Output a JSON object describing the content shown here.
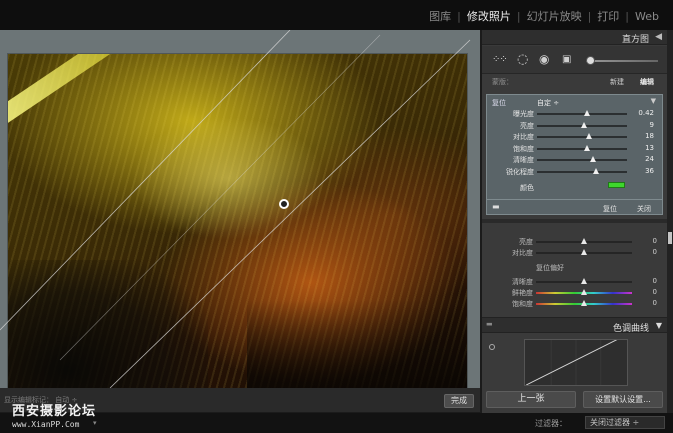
{
  "modules": {
    "library": "图库",
    "develop": "修改照片",
    "slideshow": "幻灯片放映",
    "print": "打印",
    "web": "Web",
    "separator": "|"
  },
  "right_panel": {
    "histogram_title": "直方图",
    "histogram_arrow": "◀",
    "mask": {
      "label": "蒙版：",
      "new": "新建",
      "edit": "编辑"
    },
    "adjustment": {
      "reset_tag": "复位",
      "preset": "自定 ÷",
      "rows": [
        {
          "label": "曝光度",
          "value": "0.42",
          "knob_pct": 55
        },
        {
          "label": "亮度",
          "value": "9",
          "knob_pct": 52
        },
        {
          "label": "对比度",
          "value": "18",
          "knob_pct": 58
        },
        {
          "label": "饱和度",
          "value": "13",
          "knob_pct": 56
        },
        {
          "label": "清晰度",
          "value": "24",
          "knob_pct": 62
        },
        {
          "label": "锐化程度",
          "value": "36",
          "knob_pct": 66
        }
      ],
      "color_label": "颜色",
      "color_swatch": "#3ed62c",
      "reset_button": "复位",
      "close_button": "关闭"
    },
    "basic": {
      "rows": [
        {
          "label": "亮度",
          "value": "0",
          "knob_pct": 50
        },
        {
          "label": "对比度",
          "value": "0",
          "knob_pct": 50
        }
      ],
      "presence_title": "复位偏好",
      "presence_rows": [
        {
          "label": "清晰度",
          "value": "0",
          "knob_pct": 50
        },
        {
          "label": "鲜艳度",
          "value": "0",
          "knob_pct": 50
        },
        {
          "label": "饱和度",
          "value": "0",
          "knob_pct": 50
        }
      ]
    },
    "tone_curve_title": "色调曲线",
    "tone_curve_arrow": "▼",
    "prev_button": "上一张",
    "set_default_button": "设置默认设置..."
  },
  "toolbar": {
    "left_text": "显示编辑标记：   自动 ÷",
    "done_button": "完成"
  },
  "watermark": {
    "title": "西安摄影论坛",
    "url": "www.XianPP.Com"
  },
  "status": {
    "filter_label": "过滤器：",
    "filter_value": "关闭过滤器 ÷",
    "left": "▾"
  }
}
